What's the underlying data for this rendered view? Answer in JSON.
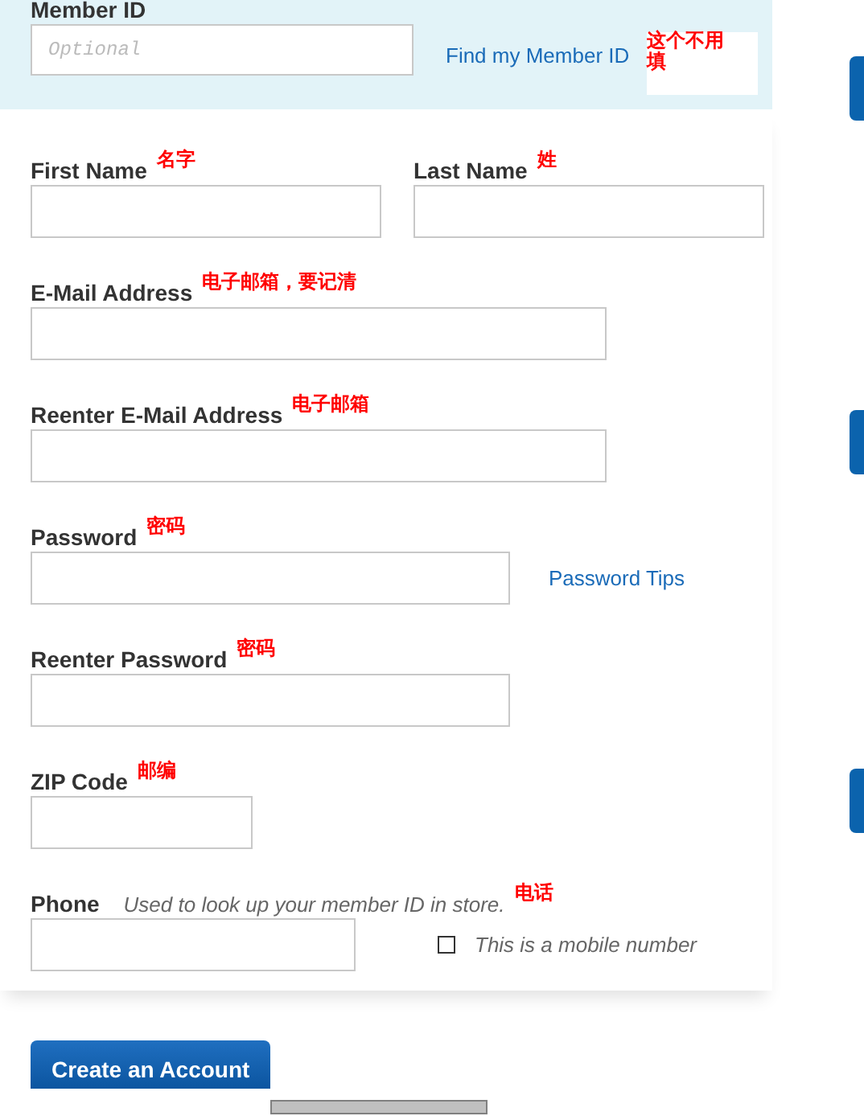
{
  "member": {
    "label": "Member ID",
    "placeholder": "Optional",
    "link": "Find my Member ID",
    "note": "这个不用填"
  },
  "rows": [
    {
      "kind": "pair",
      "fields": [
        {
          "label": "First Name",
          "note": "名字"
        },
        {
          "label": "Last Name",
          "note": "姓"
        }
      ]
    },
    {
      "kind": "email",
      "fields": [
        {
          "label": "E-Mail Address",
          "note": "电子邮箱，要记清"
        }
      ]
    },
    {
      "kind": "email",
      "fields": [
        {
          "label": "Reenter E-Mail Address",
          "note": "电子邮箱"
        }
      ]
    },
    {
      "kind": "password",
      "fields": [
        {
          "label": "Password",
          "note": "密码"
        }
      ],
      "link": "Password Tips"
    },
    {
      "kind": "password",
      "fields": [
        {
          "label": "Reenter Password",
          "note": "密码"
        }
      ]
    },
    {
      "kind": "zip",
      "fields": [
        {
          "label": "ZIP Code",
          "note": "邮编"
        }
      ]
    },
    {
      "kind": "phone",
      "fields": [
        {
          "label": "Phone",
          "note": "电话"
        }
      ],
      "hint": "Used to look up your member ID in store.",
      "checkbox": {
        "label": "This is a mobile number",
        "checked": false
      }
    }
  ],
  "submit": "Create an Account"
}
